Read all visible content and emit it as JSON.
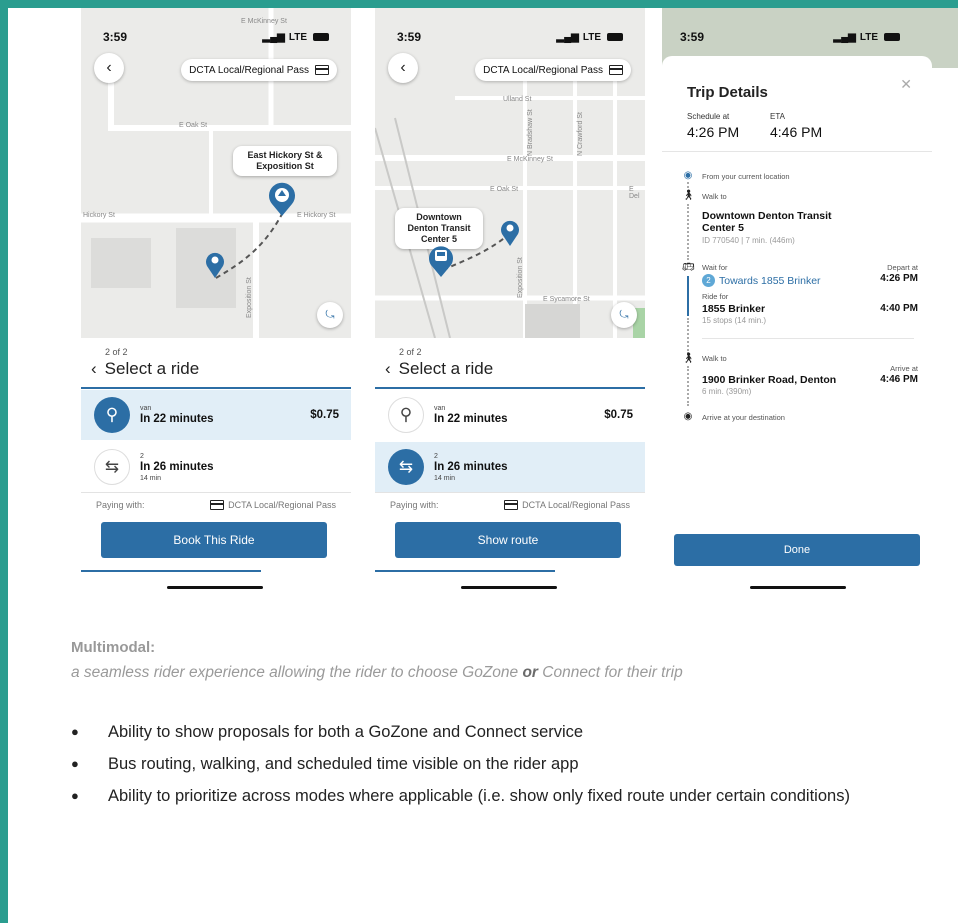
{
  "colors": {
    "frame": "#2a9d8f",
    "primary": "#2c6ea5",
    "selected_row": "#e1eef7"
  },
  "screens": [
    {
      "status": {
        "time": "3:59",
        "signal": "LTE"
      },
      "pass_pill": "DCTA Local/Regional Pass",
      "map_labels": {
        "stop": "East Hickory St & Exposition St",
        "streets": [
          "E McKinney St",
          "E Oak St",
          "Hickory St",
          "E Hickory St",
          "Exposition St"
        ]
      },
      "sheet": {
        "step": "2 of 2",
        "title": "Select a ride"
      },
      "rides": [
        {
          "type": "van",
          "eta": "In 22 minutes",
          "price": "$0.75",
          "icon": "van-pin-icon"
        },
        {
          "type": "2",
          "eta": "In 26 minutes",
          "duration": "14 min",
          "icon": "bus-transfer-icon"
        }
      ],
      "paying_label": "Paying with:",
      "paying_value": "DCTA Local/Regional Pass",
      "button": "Book This Ride"
    },
    {
      "status": {
        "time": "3:59",
        "signal": "LTE"
      },
      "pass_pill": "DCTA Local/Regional Pass",
      "map_labels": {
        "stop": "Downtown Denton Transit Center 5",
        "streets": [
          "Ulland St",
          "E McKinney St",
          "E Oak St",
          "E Del",
          "N Bradshaw St",
          "Exposition St",
          "N Crawford St",
          "E Sycamore St"
        ]
      },
      "sheet": {
        "step": "2 of 2",
        "title": "Select a ride"
      },
      "rides": [
        {
          "type": "van",
          "eta": "In 22 minutes",
          "price": "$0.75",
          "icon": "van-pin-icon"
        },
        {
          "type": "2",
          "eta": "In 26 minutes",
          "duration": "14 min",
          "icon": "bus-transfer-icon"
        }
      ],
      "paying_label": "Paying with:",
      "paying_value": "DCTA Local/Regional Pass",
      "button": "Show route"
    },
    {
      "status": {
        "time": "3:59",
        "signal": "LTE"
      },
      "title": "Trip Details",
      "schedule_label": "Schedule at",
      "schedule_value": "4:26 PM",
      "eta_label": "ETA",
      "eta_value": "4:46 PM",
      "steps": {
        "from": "From your current location",
        "walk1_label": "Walk to",
        "walk1_dest": "Downtown Denton Transit Center 5",
        "walk1_meta": "ID 770540 | 7 min. (446m)",
        "wait_label": "Wait for",
        "route_num": "2",
        "route_dir": "Towards 1855 Brinker",
        "depart_label": "Depart at",
        "depart_time": "4:26 PM",
        "ride_label": "Ride for",
        "ride_dest": "1855 Brinker",
        "ride_time": "4:40 PM",
        "ride_meta": "15 stops (14 min.)",
        "walk2_label": "Walk to",
        "walk2_dest": "1900 Brinker Road, Denton",
        "walk2_meta": "6 min. (390m)",
        "arrive_label": "Arrive at",
        "arrive_time": "4:46 PM",
        "final": "Arrive at your destination"
      },
      "button": "Done"
    }
  ],
  "caption": {
    "title": "Multimodal:",
    "sub_a": "a seamless rider experience allowing the rider to choose GoZone ",
    "sub_or": "or",
    "sub_b": " Connect for their trip"
  },
  "bullets": [
    "Ability to show proposals for both a GoZone and Connect service",
    "Bus routing, walking, and scheduled time visible on the rider app",
    "Ability to prioritize across modes where applicable (i.e. show only fixed route under certain conditions)"
  ]
}
